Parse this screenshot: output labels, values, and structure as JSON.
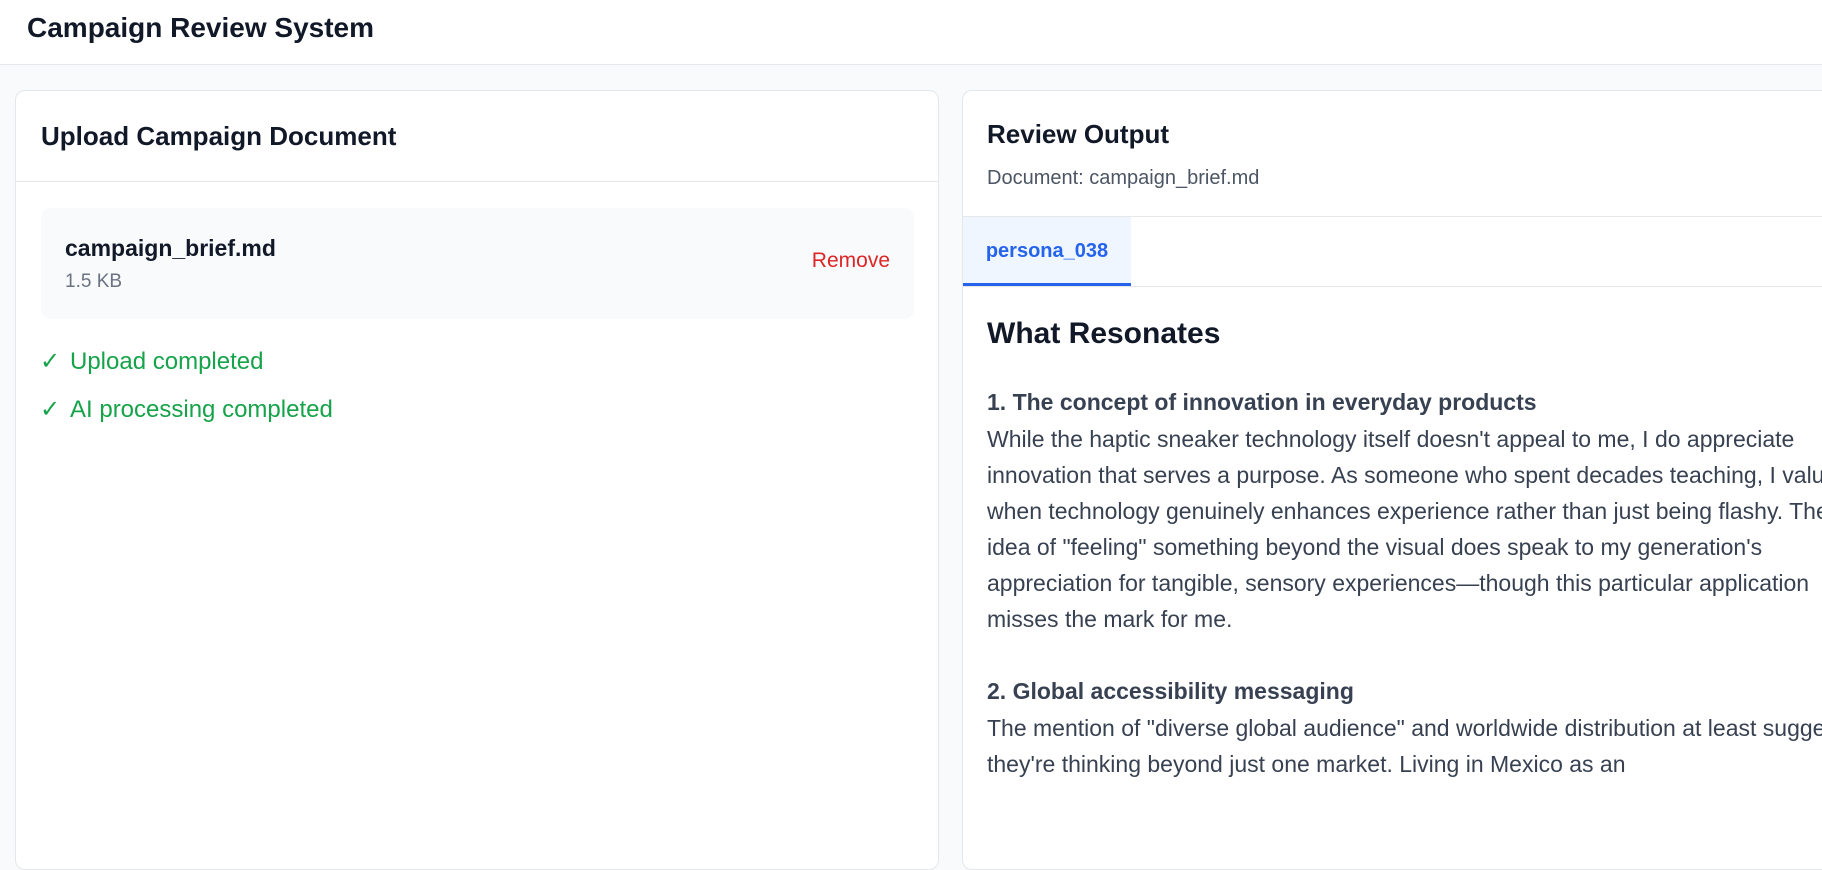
{
  "app": {
    "title": "Campaign Review System"
  },
  "upload": {
    "title": "Upload Campaign Document",
    "file": {
      "name": "campaign_brief.md",
      "size": "1.5 KB",
      "remove_label": "Remove"
    },
    "statuses": [
      {
        "icon": "check-icon",
        "glyph": "✓",
        "text": "Upload completed"
      },
      {
        "icon": "check-icon",
        "glyph": "✓",
        "text": "AI processing completed"
      }
    ]
  },
  "review": {
    "title": "Review Output",
    "document_line": "Document: campaign_brief.md",
    "tabs": [
      {
        "label": "persona_038",
        "active": true
      }
    ],
    "content": {
      "heading": "What Resonates",
      "sections": [
        {
          "title": "1. The concept of innovation in everyday products",
          "body": "While the haptic sneaker technology itself doesn't appeal to me, I do appreciate innovation that serves a purpose. As someone who spent decades teaching, I value when technology genuinely enhances experience rather than just being flashy. The idea of \"feeling\" something beyond the visual does speak to my generation's appreciation for tangible, sensory experiences—though this particular application misses the mark for me."
        },
        {
          "title": "2. Global accessibility messaging",
          "body": "The mention of \"diverse global audience\" and worldwide distribution at least suggests they're thinking beyond just one market. Living in Mexico as an"
        }
      ]
    }
  },
  "colors": {
    "accent": "#2563eb",
    "success": "#16a34a",
    "danger": "#dc2626",
    "border": "#e5e7eb",
    "background": "#f9fafb"
  }
}
